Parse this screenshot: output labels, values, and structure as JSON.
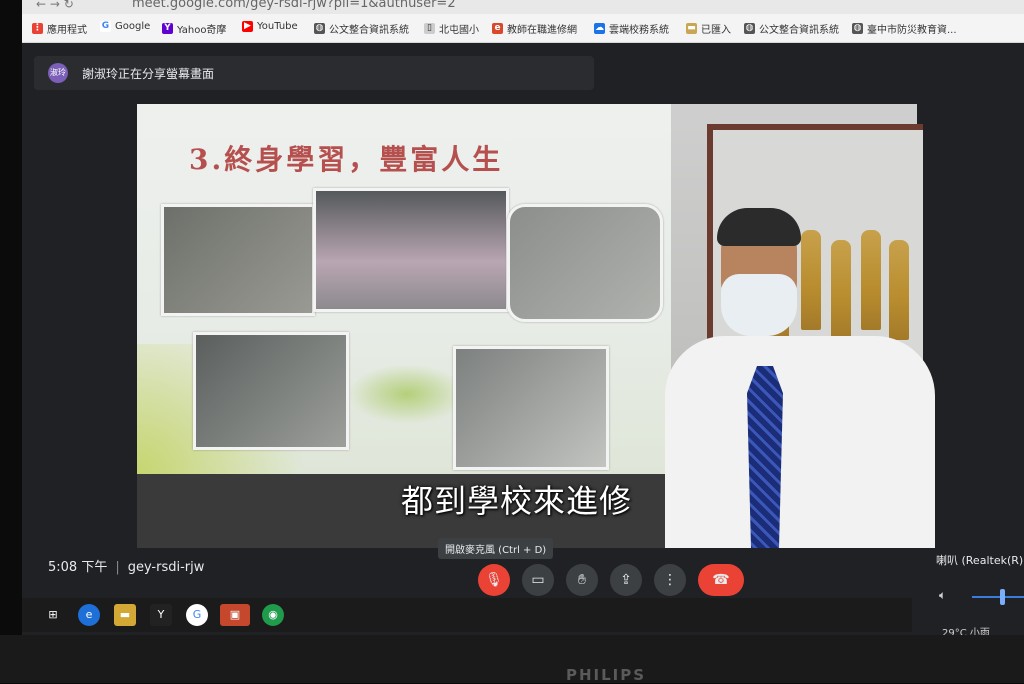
{
  "browser": {
    "url": "meet.google.com/gey-rsdi-rjw?pli=1&authuser=2",
    "bookmarks": [
      {
        "label": "應用程式",
        "icon": "apps-grid-icon"
      },
      {
        "label": "Google",
        "icon": "google-icon"
      },
      {
        "label": "Yahoo奇摩",
        "icon": "yahoo-icon"
      },
      {
        "label": "YouTube",
        "icon": "youtube-icon"
      },
      {
        "label": "公文整合資訊系統",
        "icon": "globe-icon"
      },
      {
        "label": "北屯國小",
        "icon": "page-icon"
      },
      {
        "label": "教師在職進修網",
        "icon": "edu-icon"
      },
      {
        "label": "雲端校務系統",
        "icon": "cloud-icon"
      },
      {
        "label": "已匯入",
        "icon": "folder-icon"
      },
      {
        "label": "公文整合資訊系統",
        "icon": "globe-icon"
      },
      {
        "label": "臺中市防災教育資...",
        "icon": "globe-icon"
      }
    ]
  },
  "meet": {
    "presenter_badge": "淑玲",
    "presenter_text": "謝淑玲正在分享螢幕畫面",
    "slide_title": "3.終身學習，豐富人生",
    "caption": "都到學校來進修",
    "time": "5:08 下午",
    "separator": "|",
    "meeting_code": "gey-rsdi-rjw",
    "tooltip": "開啟麥克風 (Ctrl + D)",
    "speaker_label": "喇叭 (Realtek(R) A",
    "volume_level": 0.55
  },
  "taskbar": {
    "weather": "29°C 小雨"
  },
  "monitor": {
    "brand": "PHILIPS"
  }
}
